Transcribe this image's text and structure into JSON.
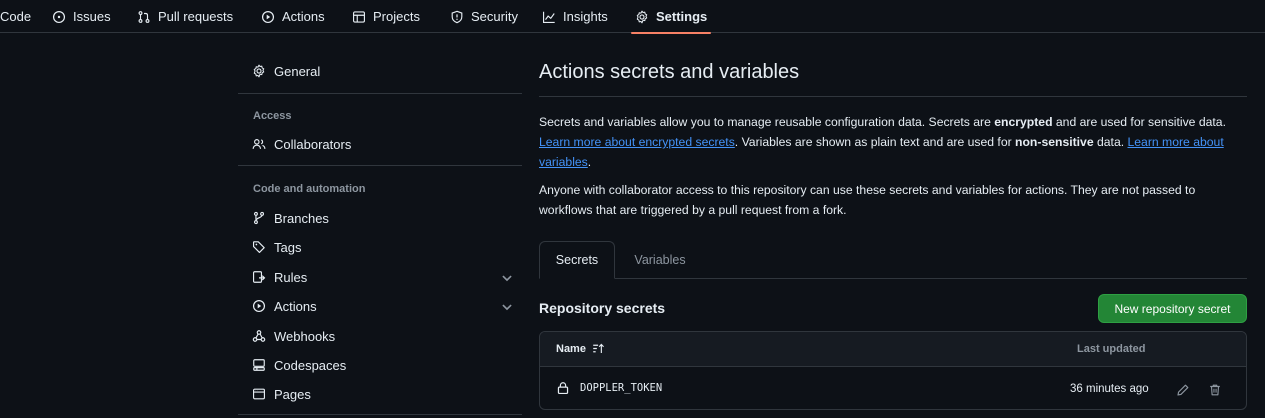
{
  "topnav": {
    "tabs": [
      {
        "label": "Code",
        "icon": "code-icon"
      },
      {
        "label": "Issues",
        "icon": "issue-icon"
      },
      {
        "label": "Pull requests",
        "icon": "pull-request-icon"
      },
      {
        "label": "Actions",
        "icon": "play-icon"
      },
      {
        "label": "Projects",
        "icon": "table-icon"
      },
      {
        "label": "Security",
        "icon": "shield-icon"
      },
      {
        "label": "Insights",
        "icon": "graph-icon"
      },
      {
        "label": "Settings",
        "icon": "gear-icon",
        "active": true
      }
    ]
  },
  "sidebar": {
    "general": {
      "label": "General",
      "icon": "gear-icon"
    },
    "access_heading": "Access",
    "collaborators": {
      "label": "Collaborators",
      "icon": "people-icon"
    },
    "code_heading": "Code and automation",
    "items": [
      {
        "label": "Branches",
        "icon": "branch-icon"
      },
      {
        "label": "Tags",
        "icon": "tag-icon"
      },
      {
        "label": "Rules",
        "icon": "rules-icon",
        "expandable": true
      },
      {
        "label": "Actions",
        "icon": "play-icon",
        "expandable": true
      },
      {
        "label": "Webhooks",
        "icon": "webhook-icon"
      },
      {
        "label": "Codespaces",
        "icon": "codespaces-icon"
      },
      {
        "label": "Pages",
        "icon": "browser-icon"
      }
    ]
  },
  "main": {
    "title": "Actions secrets and variables",
    "intro": {
      "t1": "Secrets and variables allow you to manage reusable configuration data. Secrets are ",
      "b1": "encrypted",
      "t2": " and are used for sensitive data. ",
      "link1": "Learn more about encrypted secrets",
      "t3": ". Variables are shown as plain text and are used for ",
      "b2": "non-sensitive",
      "t4": " data. ",
      "link2": "Learn more about variables",
      "t5": "."
    },
    "note": "Anyone with collaborator access to this repository can use these secrets and variables for actions. They are not passed to workflows that are triggered by a pull request from a fork.",
    "tabs": [
      {
        "label": "Secrets",
        "selected": true
      },
      {
        "label": "Variables",
        "selected": false
      }
    ],
    "section_title": "Repository secrets",
    "new_button": "New repository secret",
    "table": {
      "col_name": "Name",
      "col_updated": "Last updated",
      "rows": [
        {
          "name": "DOPPLER_TOKEN",
          "updated": "36 minutes ago"
        }
      ]
    }
  },
  "colors": {
    "background": "#0d1117",
    "border": "#30363d",
    "link": "#4493f8",
    "primary_button": "#238636",
    "active_tab_underline": "#f78166",
    "muted_text": "#8d96a0"
  }
}
